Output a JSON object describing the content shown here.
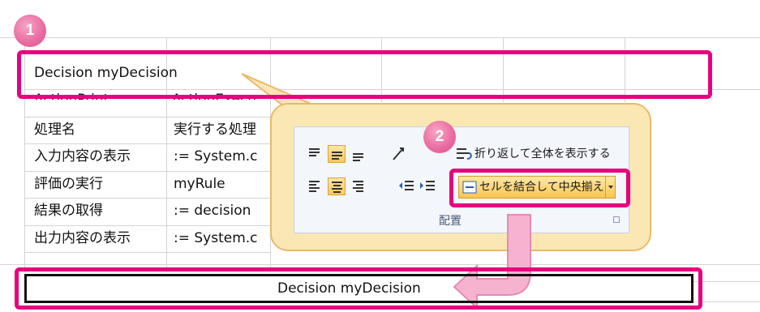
{
  "sheet": {
    "header_row": "Decision myDecision",
    "hidden_row": {
      "col_a": "ActionPrint",
      "col_b": "ActionExecu"
    },
    "rows": [
      {
        "label": "処理名",
        "value": "実行する処理"
      },
      {
        "label": "入力内容の表示",
        "value": ":= System.c"
      },
      {
        "label": "評価の実行",
        "value": "myRule"
      },
      {
        "label": "結果の取得",
        "value": ":= decision"
      },
      {
        "label": "出力内容の表示",
        "value": ":= System.c"
      }
    ],
    "merged_result": "Decision myDecision"
  },
  "ribbon": {
    "wrap_text_label": "折り返して全体を表示する",
    "merge_center_label": "セルを結合して中央揃え",
    "group_label": "配置"
  },
  "badges": {
    "step1": "1",
    "step2": "2"
  },
  "colors": {
    "annotation": "#e6007e",
    "panel_fill": "#fbe7b4",
    "arrow": "#f29ac3"
  }
}
